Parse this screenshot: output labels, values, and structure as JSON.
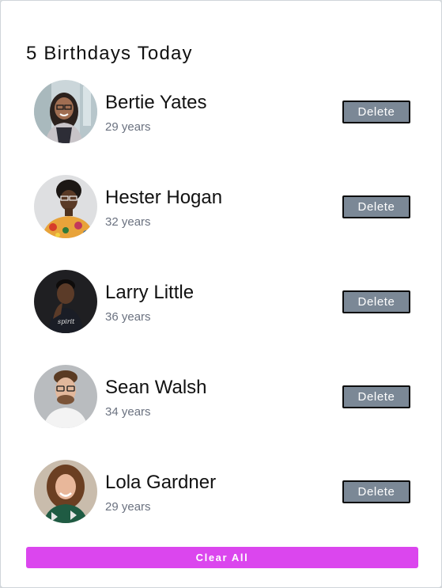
{
  "header": {
    "title": "5 Birthdays Today"
  },
  "people": [
    {
      "name": "Bertie Yates",
      "age": "29 years",
      "delete_label": "Delete"
    },
    {
      "name": "Hester Hogan",
      "age": "32 years",
      "delete_label": "Delete"
    },
    {
      "name": "Larry Little",
      "age": "36 years",
      "delete_label": "Delete"
    },
    {
      "name": "Sean Walsh",
      "age": "34 years",
      "delete_label": "Delete"
    },
    {
      "name": "Lola Gardner",
      "age": "29 years",
      "delete_label": "Delete"
    }
  ],
  "footer": {
    "clear_all_label": "Clear All"
  },
  "colors": {
    "accent": "#db46ee",
    "delete_button": "#7b8896",
    "age_text": "#6b7280"
  }
}
